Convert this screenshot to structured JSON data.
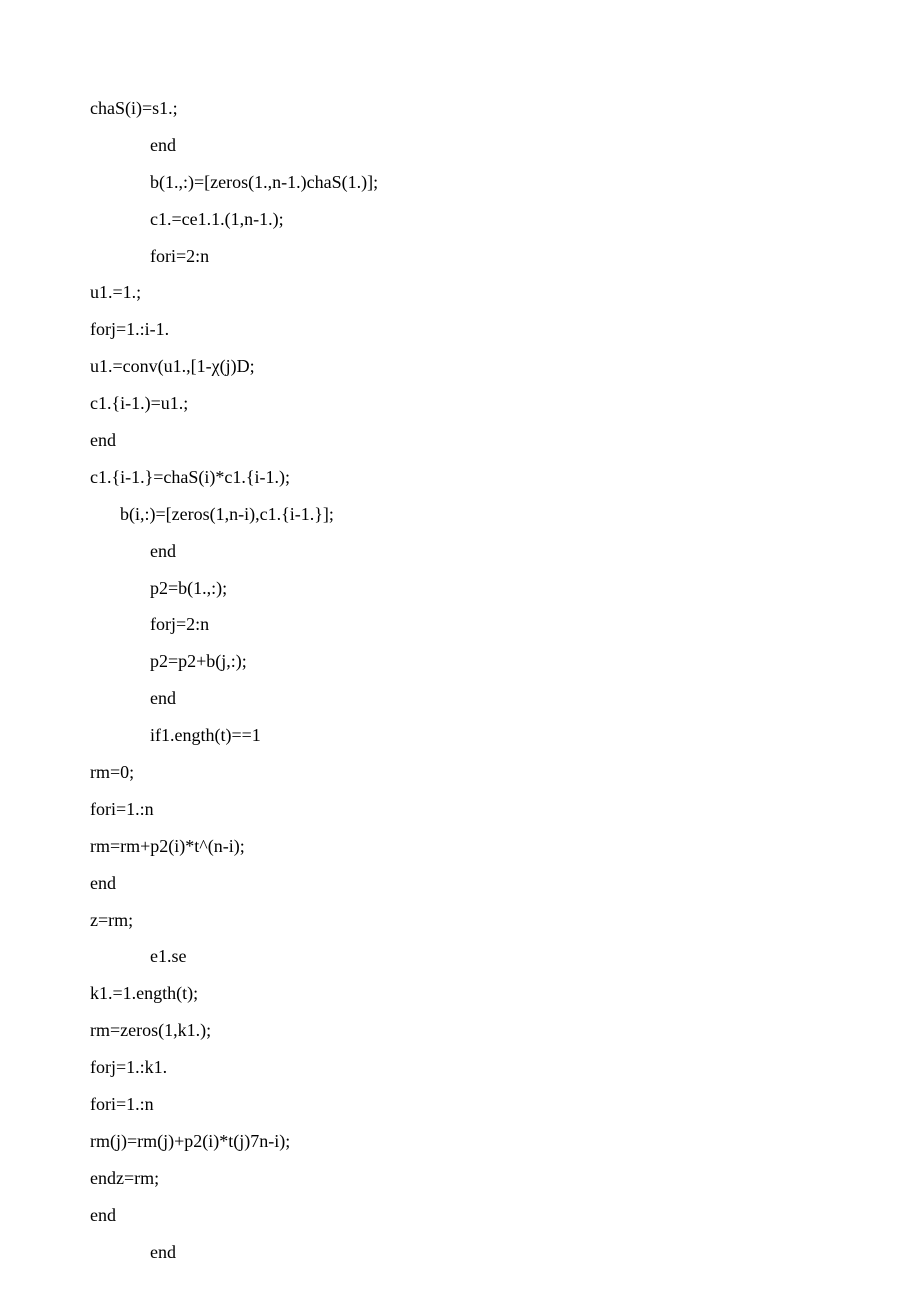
{
  "lines": [
    {
      "cls": "",
      "text": "chaS(i)=s1.;"
    },
    {
      "cls": "indent1",
      "text": "end"
    },
    {
      "cls": "indent1",
      "text": "b(1.,:)=[zeros(1.,n-1.)chaS(1.)];"
    },
    {
      "cls": "indent1",
      "text": "c1.=ce1.1.(1,n-1.);"
    },
    {
      "cls": "indent1",
      "text": "fori=2:n"
    },
    {
      "cls": "",
      "text": "u1.=1.;"
    },
    {
      "cls": "",
      "text": "forj=1.:i-1."
    },
    {
      "cls": "",
      "text": "u1.=conv(u1.,[1-χ(j)D;"
    },
    {
      "cls": "",
      "text": "c1.{i-1.)=u1.;"
    },
    {
      "cls": "",
      "text": "end"
    },
    {
      "cls": "",
      "text": "c1.{i-1.}=chaS(i)*c1.{i-1.);"
    },
    {
      "cls": "indent2",
      "text": "b(i,:)=[zeros(1,n-i),c1.{i-1.}];"
    },
    {
      "cls": "indent1",
      "text": "end"
    },
    {
      "cls": "indent1",
      "text": "p2=b(1.,:);"
    },
    {
      "cls": "indent1",
      "text": "forj=2:n"
    },
    {
      "cls": "indent1",
      "text": "p2=p2+b(j,:);"
    },
    {
      "cls": "indent1",
      "text": "end"
    },
    {
      "cls": "indent1",
      "text": "if1.ength(t)==1"
    },
    {
      "cls": "",
      "text": "rm=0;"
    },
    {
      "cls": "",
      "text": "fori=1.:n"
    },
    {
      "cls": "",
      "text": "rm=rm+p2(i)*t^(n-i);"
    },
    {
      "cls": "",
      "text": "end"
    },
    {
      "cls": "",
      "text": "z=rm;"
    },
    {
      "cls": "indent1",
      "text": "e1.se"
    },
    {
      "cls": "",
      "text": "k1.=1.ength(t);"
    },
    {
      "cls": "",
      "text": "rm=zeros(1,k1.);"
    },
    {
      "cls": "",
      "text": "forj=1.:k1."
    },
    {
      "cls": "",
      "text": "fori=1.:n"
    },
    {
      "cls": "",
      "text": "rm(j)=rm(j)+p2(i)*t(j)7n-i);"
    },
    {
      "cls": "",
      "text": "endz=rm;"
    },
    {
      "cls": "",
      "text": "end"
    },
    {
      "cls": "indent1",
      "text": "end"
    }
  ]
}
